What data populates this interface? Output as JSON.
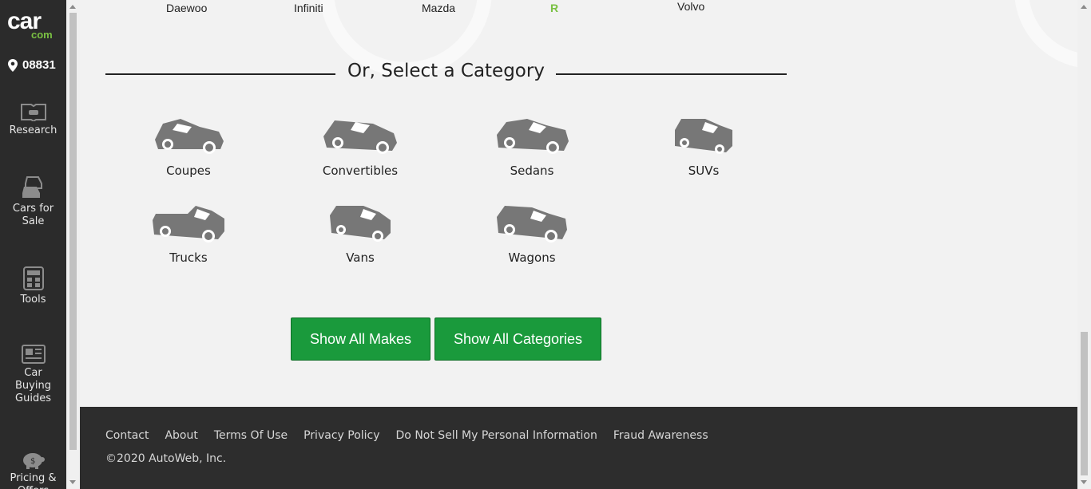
{
  "sidebar": {
    "logo_main": "car",
    "logo_sub": "com",
    "zip": "08831",
    "items": [
      {
        "label": "Research",
        "icon": "book-car-icon"
      },
      {
        "label": "Cars for Sale",
        "icon": "cars-icon"
      },
      {
        "label": "Tools",
        "icon": "calculator-icon"
      },
      {
        "label": "Car Buying Guides",
        "icon": "newspaper-icon"
      },
      {
        "label": "Pricing & Offers",
        "icon": "piggy-bank-icon"
      }
    ]
  },
  "makes": [
    "Daewoo",
    "Infiniti",
    "Mazda",
    "R",
    "Volvo"
  ],
  "category_section": {
    "heading": "Or, Select a Category",
    "categories": [
      "Coupes",
      "Convertibles",
      "Sedans",
      "SUVs",
      "Trucks",
      "Vans",
      "Wagons"
    ]
  },
  "buttons": {
    "show_all_makes": "Show All Makes",
    "show_all_categories": "Show All Categories"
  },
  "footer": {
    "links": [
      "Contact",
      "About",
      "Terms Of Use",
      "Privacy Policy",
      "Do Not Sell My Personal Information",
      "Fraud Awareness"
    ],
    "copyright": "©2020 AutoWeb, Inc."
  },
  "colors": {
    "sidebar_bg": "#2b2b2b",
    "brand_green": "#7ac143",
    "button_green": "#1a9a3c",
    "footer_bg": "#2d2d2d",
    "highlight_letter": "#7ac143"
  }
}
